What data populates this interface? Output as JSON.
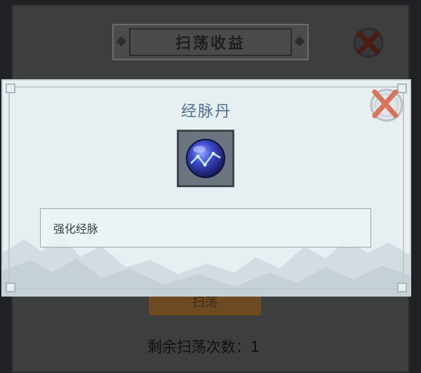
{
  "background": {
    "panel_title": "扫荡收益",
    "button_label": "扫荡",
    "remaining_text": "剩余扫荡次数：1"
  },
  "modal": {
    "title": "经脉丹",
    "item_icon": "meridian-pill-icon",
    "description": "强化经脉",
    "close_icon": "close-x-icon"
  },
  "colors": {
    "modal_bg": "#e7eff2",
    "title_text": "#4f6f92",
    "close_x": "#d9745a",
    "overlay": "#3d3f3f"
  }
}
